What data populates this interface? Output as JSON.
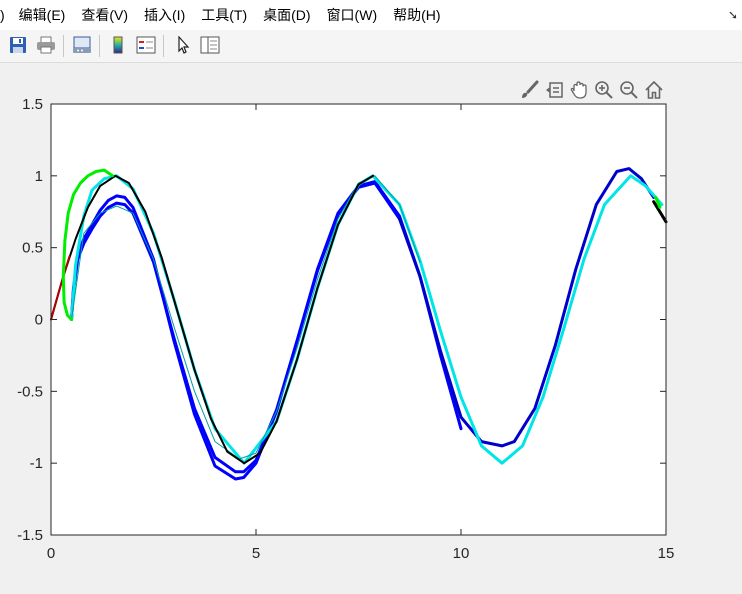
{
  "menubar": {
    "items": [
      ")",
      "编辑(E)",
      "查看(V)",
      "插入(I)",
      "工具(T)",
      "桌面(D)",
      "窗口(W)",
      "帮助(H)"
    ],
    "overflow_arrow": "➘"
  },
  "toolbar": {
    "buttons": [
      "save-icon",
      "print-icon",
      "link-figure-icon",
      "colorbar-icon",
      "legend-icon",
      "edit-plot-pointer-icon",
      "property-inspector-icon"
    ]
  },
  "axes_toolbar": {
    "buttons": [
      "brush-icon",
      "data-tips-icon",
      "pan-hand-icon",
      "zoom-in-icon",
      "zoom-out-icon",
      "home-icon"
    ]
  },
  "chart_data": {
    "type": "line",
    "title": "",
    "xlabel": "",
    "ylabel": "",
    "xlim": [
      0,
      15
    ],
    "ylim": [
      -1.5,
      1.5
    ],
    "xticks": [
      0,
      5,
      10,
      15
    ],
    "xtick_labels": [
      "0",
      "5",
      "10",
      "15"
    ],
    "yticks": [
      -1.5,
      -1,
      -0.5,
      0,
      0.5,
      1,
      1.5
    ],
    "ytick_labels": [
      "-1.5",
      "-1",
      "-0.5",
      "0",
      "0.5",
      "1",
      "1.5"
    ],
    "grid": false,
    "series": [
      {
        "color": "#0000ff",
        "width": 3,
        "x": [
          0.5,
          0.55,
          0.65,
          0.8,
          1.0,
          1.2,
          1.4,
          1.6,
          1.8,
          2.0,
          2.5,
          3.0,
          3.5,
          4.0,
          4.5,
          4.7,
          5.0,
          5.5,
          6.0,
          6.5,
          7.0,
          7.5,
          7.9,
          8.5,
          9.0,
          9.5,
          10.0
        ],
        "y": [
          0.0,
          0.22,
          0.45,
          0.56,
          0.66,
          0.76,
          0.83,
          0.86,
          0.85,
          0.78,
          0.42,
          -0.15,
          -0.66,
          -1.02,
          -1.11,
          -1.1,
          -1.0,
          -0.64,
          -0.15,
          0.35,
          0.74,
          0.93,
          0.96,
          0.72,
          0.3,
          -0.25,
          -0.76
        ]
      },
      {
        "color": "#0000ff",
        "width": 3,
        "x": [
          0.5,
          0.55,
          0.65,
          0.8,
          1.0,
          1.2,
          1.4,
          1.6,
          1.8,
          2.0,
          2.5,
          3.0,
          3.5,
          4.0,
          4.5,
          4.7,
          5.0,
          5.5,
          6.0,
          6.5,
          7.0,
          7.5,
          7.9,
          8.5
        ],
        "y": [
          0.0,
          0.2,
          0.42,
          0.53,
          0.63,
          0.72,
          0.78,
          0.81,
          0.8,
          0.74,
          0.4,
          -0.13,
          -0.62,
          -0.96,
          -1.06,
          -1.06,
          -0.98,
          -0.63,
          -0.15,
          0.34,
          0.73,
          0.92,
          0.95,
          0.7
        ]
      },
      {
        "color": "#0000cc",
        "width": 3,
        "x": [
          8.5,
          9.0,
          9.5,
          10.0,
          10.5,
          11.0,
          11.3,
          11.8,
          12.3,
          12.8,
          13.3,
          13.8,
          14.1,
          14.4,
          14.7
        ],
        "y": [
          0.7,
          0.3,
          -0.22,
          -0.68,
          -0.85,
          -0.88,
          -0.85,
          -0.62,
          -0.18,
          0.35,
          0.8,
          1.03,
          1.05,
          0.98,
          0.85
        ]
      },
      {
        "color": "#00e5e5",
        "width": 3,
        "x": [
          0.5,
          0.6,
          0.8,
          1.0,
          1.3,
          1.6,
          2.0,
          2.5,
          3.0,
          3.5,
          4.0,
          4.71,
          5.5,
          6.0,
          6.5,
          7.0,
          7.5,
          7.85,
          8.5,
          9.0,
          9.5,
          10.0,
          10.5,
          11.0,
          11.5,
          12.0,
          12.5,
          13.0,
          13.5,
          14.14,
          14.5,
          14.9
        ],
        "y": [
          0.0,
          0.38,
          0.72,
          0.9,
          0.98,
          1.0,
          0.91,
          0.6,
          0.14,
          -0.35,
          -0.76,
          -1.0,
          -0.71,
          -0.28,
          0.22,
          0.66,
          0.94,
          1.0,
          0.8,
          0.41,
          -0.08,
          -0.54,
          -0.88,
          -1.0,
          -0.88,
          -0.54,
          -0.07,
          0.42,
          0.8,
          1.0,
          0.93,
          0.8
        ]
      },
      {
        "color": "#00a0a0",
        "width": 1,
        "x": [
          0.5,
          0.8,
          1.2,
          1.6,
          2.0,
          2.5,
          3.0,
          3.5,
          4.0,
          4.6,
          5.0,
          5.5,
          6.0,
          6.5,
          7.0,
          7.5,
          7.9,
          8.5,
          9.0
        ],
        "y": [
          0.0,
          0.6,
          0.74,
          0.79,
          0.74,
          0.42,
          -0.05,
          -0.5,
          -0.85,
          -0.97,
          -0.93,
          -0.64,
          -0.2,
          0.28,
          0.7,
          0.95,
          1.0,
          0.8,
          0.4
        ]
      },
      {
        "color": "#000000",
        "width": 2,
        "x": [
          0.0,
          0.3,
          0.6,
          0.9,
          1.2,
          1.571,
          1.9,
          2.3,
          2.7,
          3.1,
          3.5,
          3.9,
          4.3,
          4.712,
          5.1,
          5.5,
          6.0,
          6.5,
          7.0,
          7.5,
          7.854
        ],
        "y": [
          0.0,
          0.3,
          0.56,
          0.78,
          0.93,
          1.0,
          0.95,
          0.75,
          0.43,
          0.04,
          -0.35,
          -0.69,
          -0.92,
          -1.0,
          -0.93,
          -0.71,
          -0.28,
          0.22,
          0.66,
          0.94,
          1.0
        ]
      },
      {
        "color": "#000000",
        "width": 3,
        "x": [
          14.7,
          15.0
        ],
        "y": [
          0.82,
          0.68
        ]
      },
      {
        "color": "#b00000",
        "width": 2,
        "x": [
          0.0,
          0.15,
          0.3,
          0.45
        ],
        "y": [
          0.0,
          0.15,
          0.3,
          0.44
        ]
      },
      {
        "color": "#00ee00",
        "width": 3,
        "x": [
          0.5,
          0.4,
          0.32,
          0.3,
          0.34,
          0.42,
          0.55,
          0.72,
          0.9,
          1.1,
          1.3,
          1.4,
          1.5
        ],
        "y": [
          0.0,
          0.03,
          0.12,
          0.3,
          0.55,
          0.74,
          0.87,
          0.95,
          1.0,
          1.03,
          1.04,
          1.02,
          1.0
        ]
      },
      {
        "color": "#00ee00",
        "width": 3,
        "x": [
          14.75,
          14.85
        ],
        "y": [
          0.85,
          0.78
        ]
      }
    ]
  }
}
